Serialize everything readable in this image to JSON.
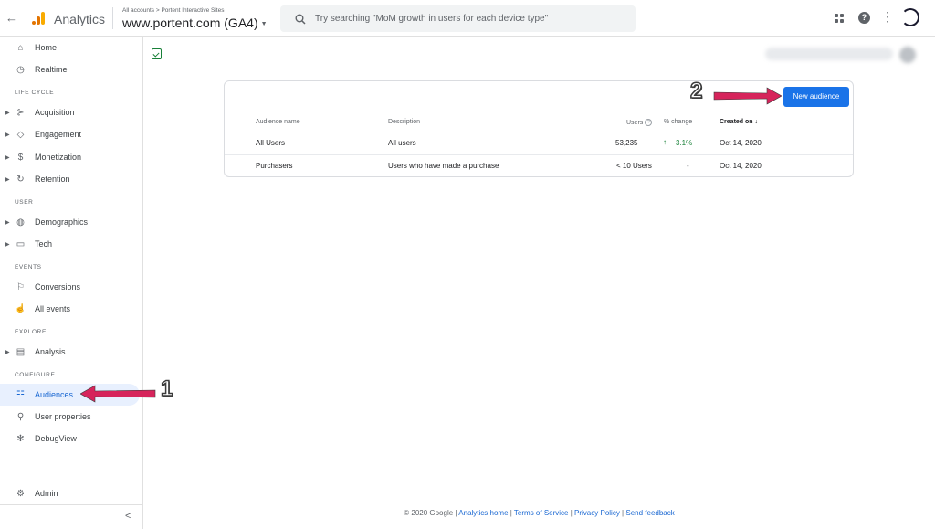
{
  "header": {
    "back_arrow": "←",
    "app_name": "Analytics",
    "breadcrumb": "All accounts > Portent Interactive Sites",
    "property_name": "www.portent.com (GA4)",
    "search_placeholder": "Try searching \"MoM growth in users for each device type\""
  },
  "sidebar": {
    "items": [
      {
        "label": "Home",
        "icon": "home-icon"
      },
      {
        "label": "Realtime",
        "icon": "clock-icon"
      },
      {
        "label": "Acquisition",
        "icon": "acquisition-icon"
      },
      {
        "label": "Engagement",
        "icon": "tag-icon"
      },
      {
        "label": "Monetization",
        "icon": "dollar-icon"
      },
      {
        "label": "Retention",
        "icon": "retention-icon"
      },
      {
        "label": "Demographics",
        "icon": "globe-icon"
      },
      {
        "label": "Tech",
        "icon": "devices-icon"
      },
      {
        "label": "Conversions",
        "icon": "flag-icon"
      },
      {
        "label": "All events",
        "icon": "touch-icon"
      },
      {
        "label": "Analysis",
        "icon": "analysis-icon"
      },
      {
        "label": "Audiences",
        "icon": "audiences-icon"
      },
      {
        "label": "User properties",
        "icon": "user-properties-icon"
      },
      {
        "label": "DebugView",
        "icon": "bug-icon"
      },
      {
        "label": "Admin",
        "icon": "gear-icon"
      }
    ],
    "sections": [
      "LIFE CYCLE",
      "USER",
      "EVENTS",
      "EXPLORE",
      "CONFIGURE"
    ],
    "active": "Audiences",
    "collapse_glyph": "<"
  },
  "table": {
    "new_button": "New audience",
    "headers": {
      "name": "Audience name",
      "description": "Description",
      "users": "Users",
      "change": "% change",
      "created": "Created on"
    },
    "sort_glyph": "↓",
    "rows": [
      {
        "name": "All Users",
        "description": "All users",
        "users": "53,235",
        "change": "3.1%",
        "trend": "up",
        "created": "Oct 14, 2020"
      },
      {
        "name": "Purchasers",
        "description": "Users who have made a purchase",
        "users": "< 10 Users",
        "change": "-",
        "trend": "none",
        "created": "Oct 14, 2020"
      }
    ]
  },
  "annotations": {
    "step1": "1",
    "step2": "2"
  },
  "footer": {
    "copyright": "© 2020 Google",
    "links": [
      "Analytics home",
      "Terms of Service",
      "Privacy Policy",
      "Send feedback"
    ],
    "separator": " | "
  },
  "colors": {
    "accent": "#1a73e8",
    "active_bg": "#e8f0fe",
    "arrow": "#d6245b",
    "positive": "#188038"
  }
}
